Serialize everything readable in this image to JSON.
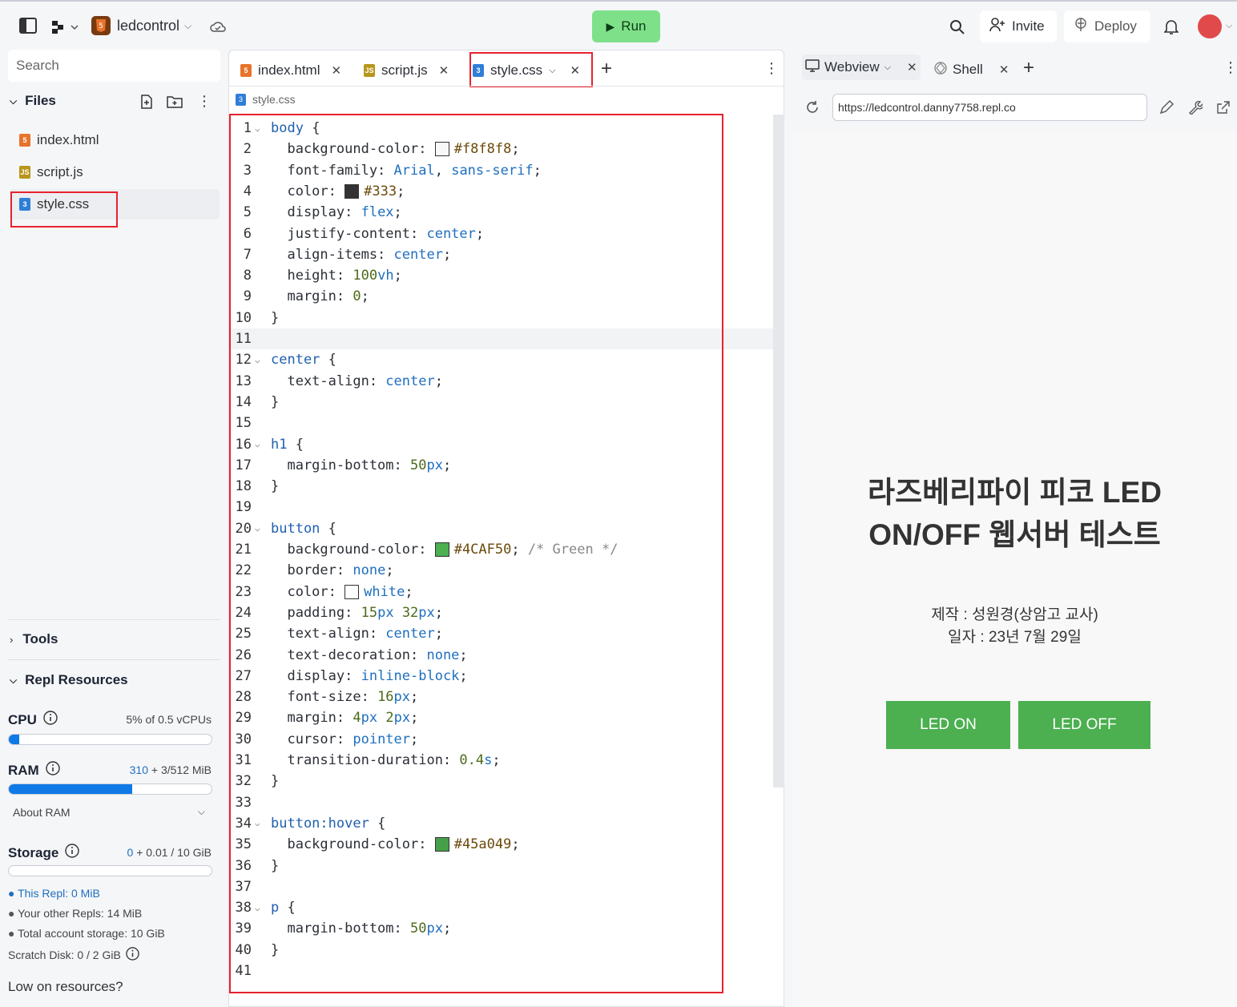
{
  "topbar": {
    "project_name": "ledcontrol",
    "run_label": "Run",
    "invite_label": "Invite",
    "deploy_label": "Deploy"
  },
  "sidebar": {
    "search_placeholder": "Search",
    "files_header": "Files",
    "files": [
      {
        "name": "index.html",
        "type": "html"
      },
      {
        "name": "script.js",
        "type": "js"
      },
      {
        "name": "style.css",
        "type": "css"
      }
    ],
    "tools_header": "Tools",
    "resources_header": "Repl Resources",
    "cpu": {
      "label": "CPU",
      "value": "5% of 0.5 vCPUs",
      "fraction": 0.05
    },
    "ram": {
      "label": "RAM",
      "value_highlight": "310",
      "value_rest": "+ 3/512 MiB",
      "fraction": 0.61
    },
    "about_ram": "About RAM",
    "storage": {
      "label": "Storage",
      "value_highlight": "0",
      "value_rest": "+ 0.01 / 10 GiB",
      "fraction": 0.0
    },
    "storage_items": [
      "This Repl: 0 MiB",
      "Your other Repls: 14 MiB",
      "Total account storage: 10 GiB"
    ],
    "scratch_disk": "Scratch Disk: 0 / 2 GiB",
    "low_resources": "Low on resources?"
  },
  "editor": {
    "tabs": [
      {
        "name": "index.html",
        "type": "html"
      },
      {
        "name": "script.js",
        "type": "js"
      },
      {
        "name": "style.css",
        "type": "css",
        "active": true
      }
    ],
    "breadcrumb": "style.css",
    "lines": [
      {
        "n": "1",
        "fold": true,
        "html": "<span class='sel'>body</span> {"
      },
      {
        "n": "2",
        "html": "  background-color: <span class='swatch' style='background:#f8f8f8'></span><span class='hex'>#f8f8f8</span>;"
      },
      {
        "n": "3",
        "html": "  font-family: <span class='kw'>Arial</span>, <span class='kw'>sans-serif</span>;"
      },
      {
        "n": "4",
        "html": "  color: <span class='swatch' style='background:#333'></span><span class='hex'>#333</span>;"
      },
      {
        "n": "5",
        "html": "  display: <span class='kw'>flex</span>;"
      },
      {
        "n": "6",
        "html": "  justify-content: <span class='kw'>center</span>;"
      },
      {
        "n": "7",
        "html": "  align-items: <span class='kw'>center</span>;"
      },
      {
        "n": "8",
        "html": "  height: <span class='num'>100</span><span class='unit'>vh</span>;"
      },
      {
        "n": "9",
        "html": "  margin: <span class='num'>0</span>;"
      },
      {
        "n": "10",
        "html": "}"
      },
      {
        "n": "11",
        "html": ""
      },
      {
        "n": "12",
        "fold": true,
        "html": "<span class='sel'>center</span> {"
      },
      {
        "n": "13",
        "html": "  text-align: <span class='kw'>center</span>;"
      },
      {
        "n": "14",
        "html": "}"
      },
      {
        "n": "15",
        "html": ""
      },
      {
        "n": "16",
        "fold": true,
        "html": "<span class='sel'>h1</span> {"
      },
      {
        "n": "17",
        "html": "  margin-bottom: <span class='num'>50</span><span class='unit'>px</span>;"
      },
      {
        "n": "18",
        "html": "}"
      },
      {
        "n": "19",
        "html": ""
      },
      {
        "n": "20",
        "fold": true,
        "html": "<span class='sel'>button</span> {"
      },
      {
        "n": "21",
        "html": "  background-color: <span class='swatch' style='background:#4CAF50'></span><span class='hex'>#4CAF50</span>; <span class='cmt'>/* Green */</span>"
      },
      {
        "n": "22",
        "html": "  border: <span class='kw'>none</span>;"
      },
      {
        "n": "23",
        "html": "  color: <span class='swatch' style='background:#fff'></span><span class='kw'>white</span>;"
      },
      {
        "n": "24",
        "html": "  padding: <span class='num'>15</span><span class='unit'>px</span> <span class='num'>32</span><span class='unit'>px</span>;"
      },
      {
        "n": "25",
        "html": "  text-align: <span class='kw'>center</span>;"
      },
      {
        "n": "26",
        "html": "  text-decoration: <span class='kw'>none</span>;"
      },
      {
        "n": "27",
        "html": "  display: <span class='kw'>inline-block</span>;"
      },
      {
        "n": "28",
        "html": "  font-size: <span class='num'>16</span><span class='unit'>px</span>;"
      },
      {
        "n": "29",
        "html": "  margin: <span class='num'>4</span><span class='unit'>px</span> <span class='num'>2</span><span class='unit'>px</span>;"
      },
      {
        "n": "30",
        "html": "  cursor: <span class='kw'>pointer</span>;"
      },
      {
        "n": "31",
        "html": "  transition-duration: <span class='num'>0.4</span><span class='unit'>s</span>;"
      },
      {
        "n": "32",
        "html": "}"
      },
      {
        "n": "33",
        "html": ""
      },
      {
        "n": "34",
        "fold": true,
        "html": "<span class='sel'>button:hover</span> {"
      },
      {
        "n": "35",
        "html": "  background-color: <span class='swatch' style='background:#45a049'></span><span class='hex'>#45a049</span>;"
      },
      {
        "n": "36",
        "html": "}"
      },
      {
        "n": "37",
        "html": ""
      },
      {
        "n": "38",
        "fold": true,
        "html": "<span class='sel'>p</span> {"
      },
      {
        "n": "39",
        "html": "  margin-bottom: <span class='num'>50</span><span class='unit'>px</span>;"
      },
      {
        "n": "40",
        "html": "}"
      },
      {
        "n": "41",
        "html": ""
      }
    ]
  },
  "webview": {
    "tabs": [
      {
        "name": "Webview"
      },
      {
        "name": "Shell"
      }
    ],
    "url": "https://ledcontrol.danny7758.repl.co",
    "title_line1": "라즈베리파이 피코 LED",
    "title_line2": "ON/OFF 웹서버 테스트",
    "author": "제작 : 성원경(상암고 교사)",
    "date": "일자 : 23년 7월 29일",
    "btn_on": "LED ON",
    "btn_off": "LED OFF"
  },
  "colors": {
    "run_green": "#7fe08a",
    "led_green": "#4CAF50",
    "highlight_red": "#e8212e",
    "bar_blue": "#0f79e6"
  }
}
